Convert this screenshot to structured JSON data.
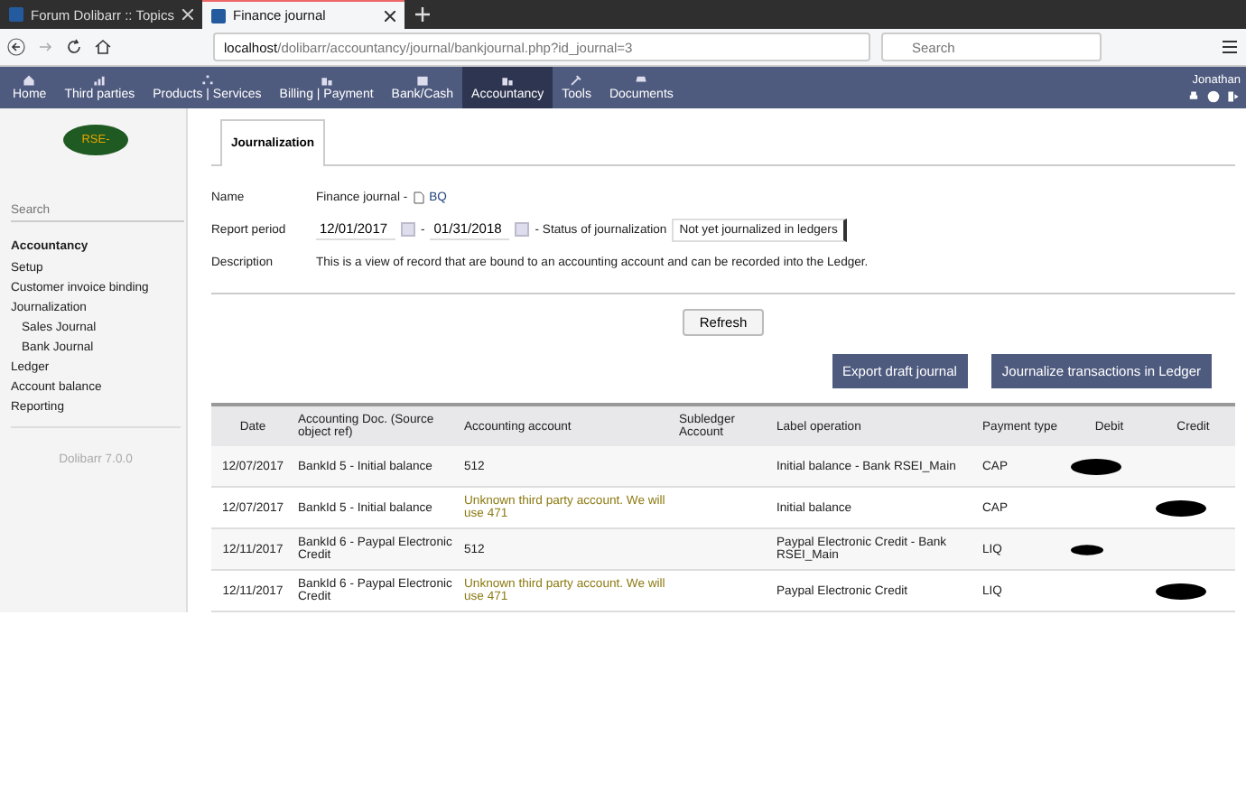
{
  "browser": {
    "tabs": [
      {
        "title": "Forum Dolibarr :: Topics",
        "selected": false
      },
      {
        "title": "Finance journal",
        "selected": true
      }
    ],
    "url_host": "localhost",
    "url_path": "/dolibarr/accountancy/journal/bankjournal.php?id_journal=3",
    "search_placeholder": "Search"
  },
  "top_menu": {
    "items": [
      {
        "label": "Home",
        "selected": false
      },
      {
        "label": "Third parties",
        "selected": false
      },
      {
        "label": "Products | Services",
        "selected": false
      },
      {
        "label": "Billing | Payment",
        "selected": false
      },
      {
        "label": "Bank/Cash",
        "selected": false
      },
      {
        "label": "Accountancy",
        "selected": true
      },
      {
        "label": "Tools",
        "selected": false
      },
      {
        "label": "Documents",
        "selected": false
      }
    ],
    "user": "Jonathan"
  },
  "sidebar": {
    "logo": "RSE-",
    "search_placeholder": "Search",
    "items": [
      {
        "label": "Accountancy",
        "kind": "heading"
      },
      {
        "label": "Setup",
        "kind": "link"
      },
      {
        "label": "Customer invoice binding",
        "kind": "link"
      },
      {
        "label": "Journalization",
        "kind": "link",
        "children": [
          {
            "label": "Sales Journal"
          },
          {
            "label": "Bank Journal"
          }
        ]
      },
      {
        "label": "Ledger",
        "kind": "link"
      },
      {
        "label": "Account balance",
        "kind": "link"
      },
      {
        "label": "Reporting",
        "kind": "link"
      }
    ],
    "version": "Dolibarr 7.0.0"
  },
  "tabs": [
    {
      "label": "Journalization",
      "selected": true
    }
  ],
  "form": {
    "name_label": "Name",
    "name_value": "Finance journal -",
    "name_link": "BQ",
    "period_label": "Report period",
    "date_from": "12/01/2017",
    "separator": "-",
    "date_to": "01/31/2018",
    "status_label": "- Status of journalization",
    "status_value": "Not yet journalized in ledgers",
    "description_label": "Description",
    "description": "This is a view of record that are bound to an accounting account and can be recorded into the Ledger."
  },
  "buttons": {
    "refresh": "Refresh",
    "actions": [
      "Export draft journal",
      "Journalize transactions in Ledger"
    ]
  },
  "table": {
    "columns": [
      "Date",
      "Accounting Doc. (Source object ref)",
      "Accounting account",
      "Subledger Account",
      "Label operation",
      "Payment type",
      "Debit",
      "Credit"
    ],
    "rows": [
      {
        "date": "12/07/2017",
        "doc": "BankId 5 - Initial balance",
        "account": "512",
        "warning": false,
        "label": "Initial balance - Bank RSEI_Main",
        "payment": "CAP",
        "debit_redacted": true,
        "credit_redacted": false
      },
      {
        "date": "12/07/2017",
        "doc": "BankId 5 - Initial balance",
        "account": "Unknown third party account. We will use 471",
        "warning": true,
        "label": "Initial balance",
        "payment": "CAP",
        "debit_redacted": false,
        "credit_redacted": true
      },
      {
        "date": "12/11/2017",
        "doc": "BankId 6 - Paypal Electronic Credit",
        "account": "512",
        "warning": false,
        "label": "Paypal Electronic Credit - Bank RSEI_Main",
        "payment": "LIQ",
        "debit_redacted": true,
        "credit_redacted": false
      },
      {
        "date": "12/11/2017",
        "doc": "BankId 6 - Paypal Electronic Credit",
        "account": "Unknown third party account. We will use 471",
        "warning": true,
        "label": "Paypal Electronic Credit",
        "payment": "LIQ",
        "debit_redacted": false,
        "credit_redacted": true
      }
    ]
  }
}
